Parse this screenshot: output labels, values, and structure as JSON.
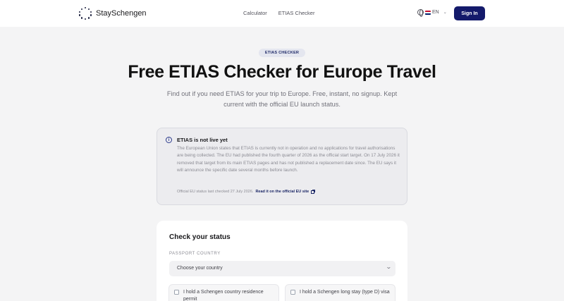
{
  "header": {
    "brand": "StaySchengen",
    "nav": [
      "Calculator",
      "ETIAS Checker"
    ],
    "language": "EN",
    "sign_in": "Sign In"
  },
  "hero": {
    "badge": "ETIAS CHECKER",
    "title": "Free ETIAS Checker for Europe Travel",
    "subtitle": "Find out if you need ETIAS for your trip to Europe. Free, instant, no signup. Kept current with the official EU launch status."
  },
  "notice": {
    "icon": "info-icon",
    "title": "ETIAS is not live yet",
    "body": "The European Union states that ETIAS is currently not in operation and no applications for travel authorisations are being collected. The EU had published the fourth quarter of 2026 as the official start target. On 17 July 2026 it removed that target from its main ETIAS pages and has not published a replacement date since. The EU says it will announce the specific date several months before launch.",
    "last_checked": "Official EU status last checked 27 July 2026.",
    "link": "Read it on the official EU site"
  },
  "form": {
    "title": "Check your status",
    "passport_label": "PASSPORT COUNTRY",
    "passport_placeholder": "Choose your country",
    "options": [
      "I hold a Schengen country residence permit",
      "I hold a Schengen long stay (type D) visa"
    ]
  },
  "colors": {
    "accent": "#141a6b",
    "badge_bg": "#e4e6ef",
    "background": "#f4f4f5"
  }
}
